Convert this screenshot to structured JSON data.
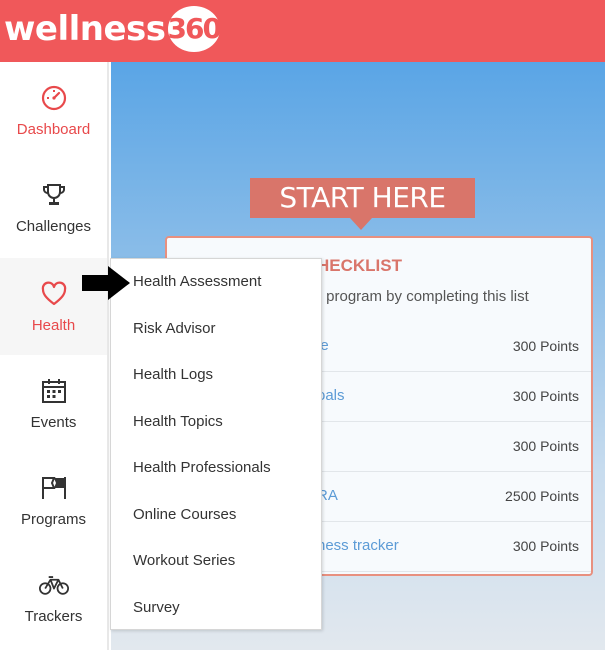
{
  "header": {
    "logo_text": "wellness",
    "logo_number": "360",
    "bg_color": "#f0585a"
  },
  "sidebar": {
    "items": [
      {
        "label": "Dashboard",
        "icon": "speedometer-icon"
      },
      {
        "label": "Challenges",
        "icon": "trophy-icon"
      },
      {
        "label": "Health",
        "icon": "heart-icon",
        "active": true
      },
      {
        "label": "Events",
        "icon": "calendar-icon"
      },
      {
        "label": "Programs",
        "icon": "flags-icon"
      },
      {
        "label": "Trackers",
        "icon": "bicycle-icon"
      }
    ],
    "active_color": "#e8494b"
  },
  "main": {
    "banner": "START HERE",
    "checklist": {
      "title_visible": "HECKLIST",
      "subtitle_visible": "r program by completing this list",
      "rows": [
        {
          "name_visible": "le",
          "points": "300 Points"
        },
        {
          "name_visible": "oals",
          "points": "300 Points"
        },
        {
          "name_visible": "",
          "points": "300 Points"
        },
        {
          "name_visible": "RA",
          "points": "2500 Points"
        },
        {
          "name_visible": "ness tracker",
          "points": "300 Points"
        }
      ]
    }
  },
  "dropdown": {
    "items": [
      "Health Assessment",
      "Risk Advisor",
      "Health Logs",
      "Health Topics",
      "Health Professionals",
      "Online Courses",
      "Workout Series",
      "Survey"
    ]
  }
}
